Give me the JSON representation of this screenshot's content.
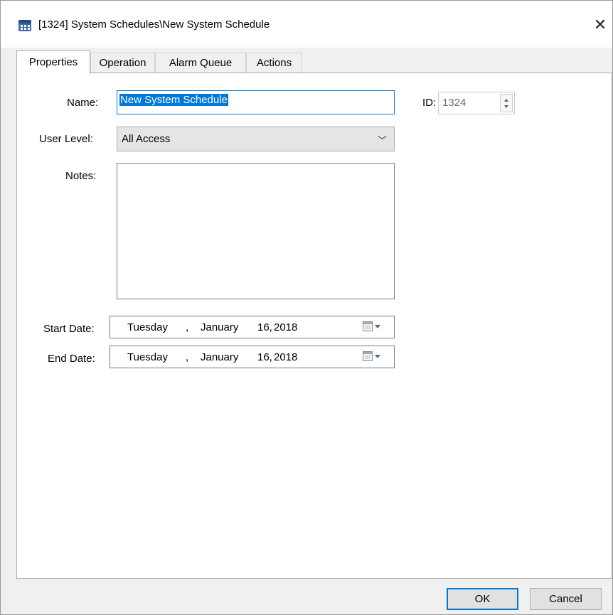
{
  "window": {
    "title": "[1324] System Schedules\\New System Schedule",
    "close_glyph": "✕",
    "icon": "calendar-icon"
  },
  "tabs": [
    {
      "label": "Properties",
      "active": true
    },
    {
      "label": "Operation",
      "active": false
    },
    {
      "label": "Alarm Queue",
      "active": false
    },
    {
      "label": "Actions",
      "active": false
    }
  ],
  "form": {
    "name_label": "Name:",
    "name_value": "New System Schedule",
    "id_label": "ID:",
    "id_value": "1324",
    "user_level_label": "User Level:",
    "user_level_value": "All Access",
    "notes_label": "Notes:",
    "notes_value": "",
    "start_date_label": "Start Date:",
    "end_date_label": "End Date:",
    "start_date": {
      "weekday": "Tuesday",
      "comma": ",",
      "month": "January",
      "day": "16,",
      "year": "2018"
    },
    "end_date": {
      "weekday": "Tuesday",
      "comma": ",",
      "month": "January",
      "day": "16,",
      "year": "2018"
    }
  },
  "buttons": {
    "ok": "OK",
    "cancel": "Cancel"
  },
  "colors": {
    "accent": "#0078d7",
    "window_bg": "#f0f0f0",
    "panel_bg": "#ffffff"
  }
}
